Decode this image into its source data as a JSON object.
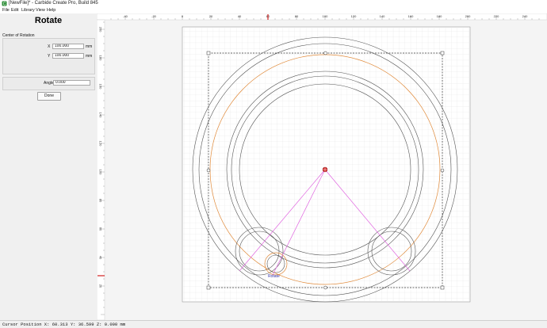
{
  "window": {
    "title": "[NewFile]* - Carbide Create Pro, Build 845"
  },
  "menu": [
    {
      "label": "File"
    },
    {
      "label": "Edit"
    },
    {
      "label": "Library"
    },
    {
      "label": "View"
    },
    {
      "label": "Help"
    }
  ],
  "panel": {
    "title": "Rotate",
    "center_label": "Center of Rotation",
    "x_label": "X",
    "x_value": "100.000",
    "y_label": "Y",
    "y_value": "100.000",
    "unit": "mm",
    "angle_label": "Angle",
    "angle_value": "0.000",
    "done_label": "Done"
  },
  "rulers": {
    "x_ticks": [
      "-40",
      "-20",
      "0",
      "20",
      "40",
      "60",
      "80",
      "100",
      "120",
      "140",
      "160",
      "180",
      "200",
      "220",
      "240"
    ],
    "y_ticks": [
      "200",
      "180",
      "160",
      "140",
      "120",
      "100",
      "80",
      "60",
      "40",
      "20"
    ]
  },
  "canvas": {
    "rotate_handle_label": "Rotate"
  },
  "colors": {
    "toolpath_orange": "#e08a3a",
    "guide_magenta": "#e066e0",
    "selection_red": "#d02020"
  },
  "status": {
    "cursor_text": "Cursor Position X: 60.313 Y: 36.599 Z: 0.000 mm"
  }
}
